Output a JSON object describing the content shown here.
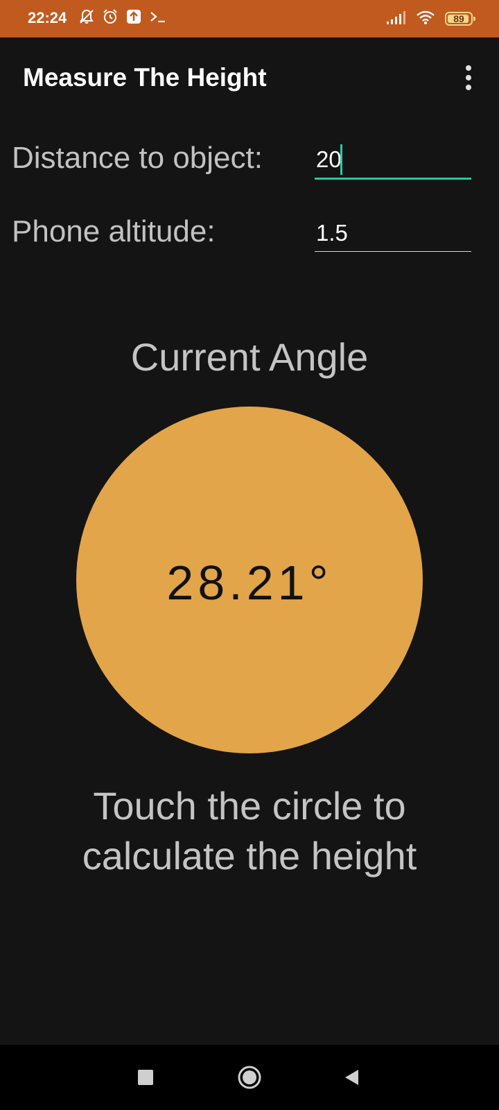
{
  "status_bar": {
    "time": "22:24",
    "battery_level": "89",
    "icons_left": [
      "notifications-off-icon",
      "alarm-icon",
      "upload-icon",
      "terminal-icon"
    ],
    "icons_right": [
      "signal-icon",
      "wifi-icon",
      "battery-icon"
    ]
  },
  "app_bar": {
    "title": "Measure The Height"
  },
  "form": {
    "distance": {
      "label": "Distance to object:",
      "value": "20"
    },
    "altitude": {
      "label": "Phone altitude:",
      "value": "1.5"
    }
  },
  "angle": {
    "label": "Current Angle",
    "value": "28.21°"
  },
  "instruction": {
    "line1": "Touch the circle to",
    "line2": "calculate the height"
  },
  "colors": {
    "status_bar": "#c15a1f",
    "background": "#141414",
    "circle": "#e2a54a",
    "accent": "#26c9a8"
  },
  "navigation": {
    "buttons": [
      "recents-square-icon",
      "home-circle-icon",
      "back-triangle-icon"
    ]
  }
}
